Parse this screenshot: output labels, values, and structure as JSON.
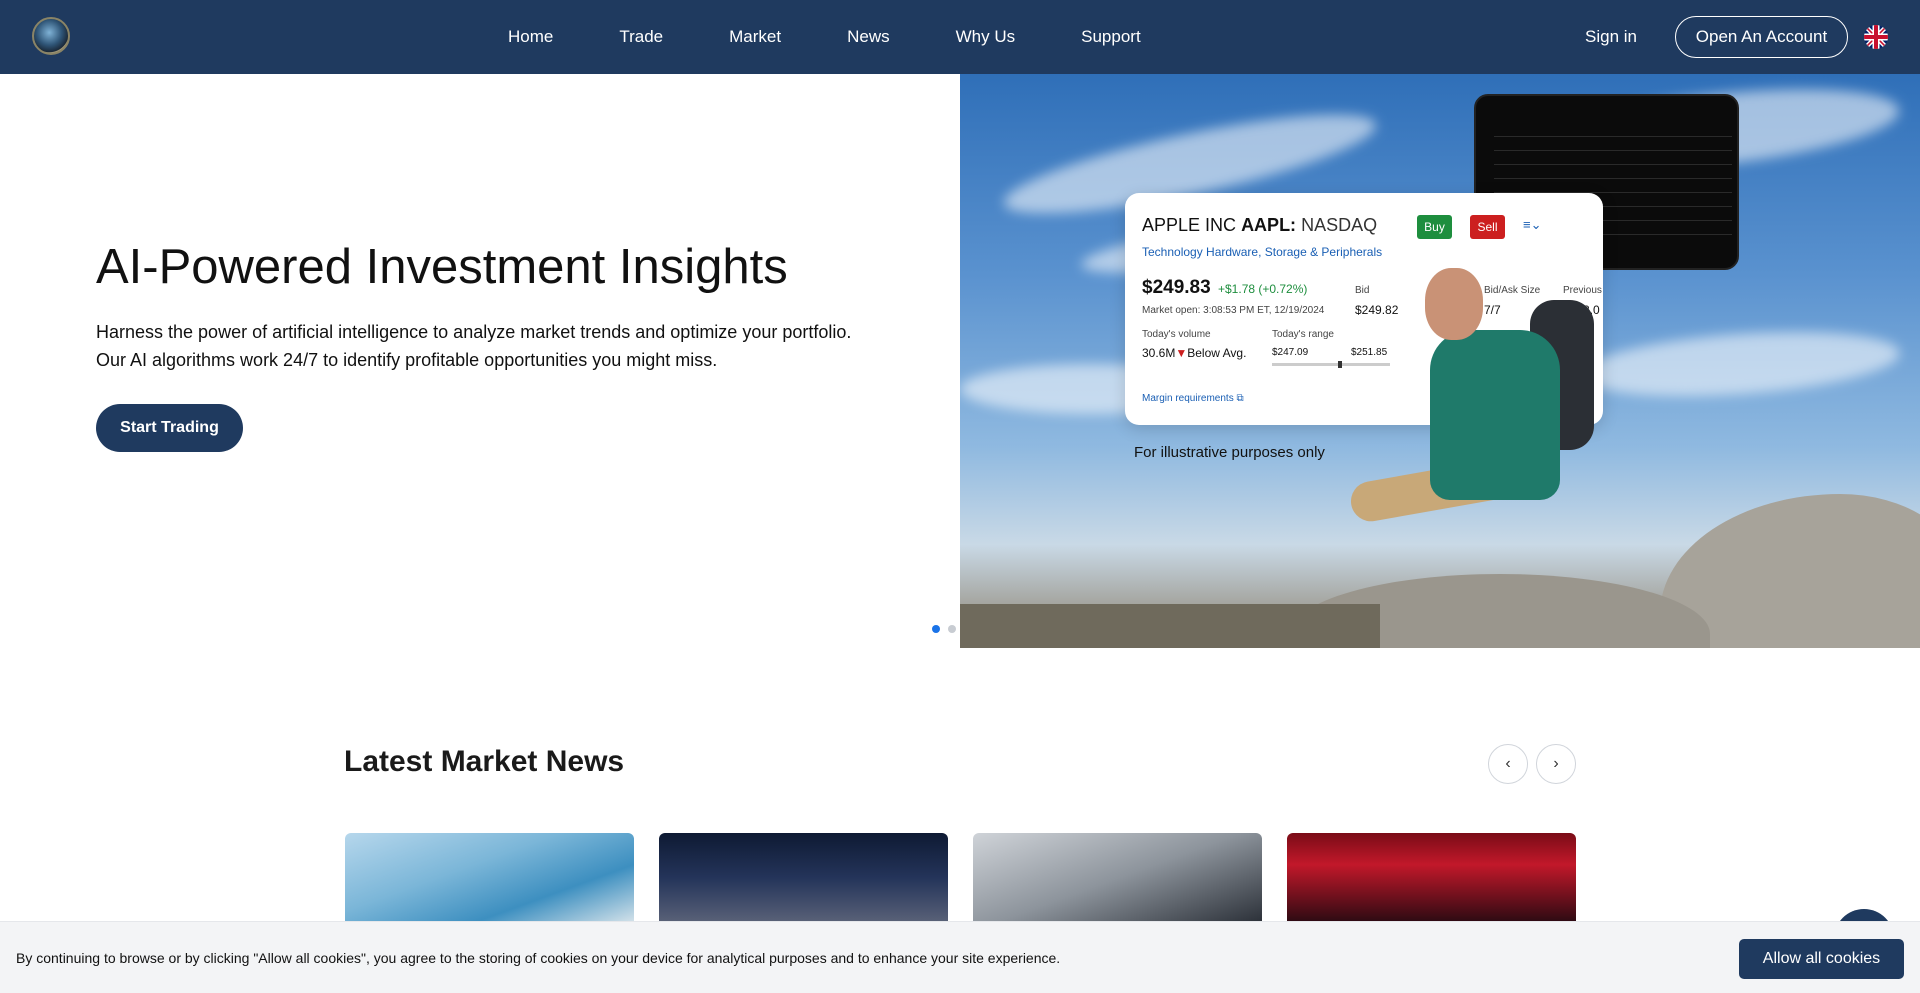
{
  "nav": {
    "links": [
      "Home",
      "Trade",
      "Market",
      "News",
      "Why Us",
      "Support"
    ],
    "sign_in": "Sign in",
    "open_account": "Open An Account"
  },
  "hero": {
    "title": "AI-Powered Investment Insights",
    "desc_line1": "Harness the power of artificial intelligence to analyze market trends and optimize your portfolio.",
    "desc_line2": "Our AI algorithms work 24/7 to identify profitable opportunities you might miss.",
    "cta": "Start Trading",
    "caption": "For illustrative purposes only",
    "slides": 2,
    "active_slide": 1
  },
  "stock_card": {
    "company": "APPLE INC",
    "ticker": "AAPL:",
    "exchange": "NASDAQ",
    "buy": "Buy",
    "sell": "Sell",
    "sector": "Technology Hardware, Storage & Peripherals",
    "price": "$249.83",
    "change": "+$1.78  (+0.72%)",
    "market_open": "Market open: 3:08:53 PM ET, 12/19/2024",
    "bid_label": "Bid",
    "bid": "$249.82",
    "bidask_label": "Bid/Ask Size",
    "bidask": "7/7",
    "prev_label": "Previous",
    "prev": "$248.0",
    "volume_label": "Today's volume",
    "volume": "30.6M",
    "volume_note": "Below Avg.",
    "range_label": "Today's range",
    "range_low": "$247.09",
    "range_high": "$251.85",
    "margin": "Margin requirements"
  },
  "news": {
    "title": "Latest Market News"
  },
  "cookie": {
    "text": "By continuing to browse or by clicking \"Allow all cookies\", you agree to the storing of cookies on your device for analytical purposes and to enhance your site experience.",
    "button": "Allow all cookies"
  },
  "colors": {
    "nav_bg": "#1f3a5f",
    "accent_blue": "#1a73e8",
    "buy_green": "#1e8e3e",
    "sell_red": "#cc1f1f"
  }
}
